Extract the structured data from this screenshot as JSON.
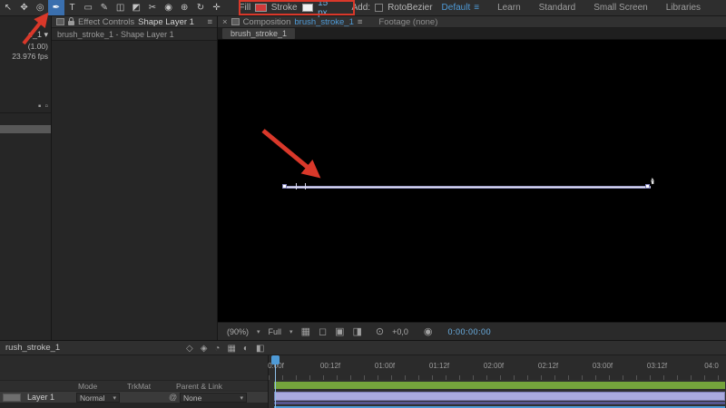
{
  "colors": {
    "accent_blue": "#4e9ad6",
    "timecode_blue": "#6db3e8",
    "annotation_red": "#d9382a",
    "render_green": "#74a33c",
    "layer_lavender": "#aaaade",
    "fill_red": "#cf3a3a"
  },
  "ui": {
    "dropdown": "▾",
    "menu": "≡",
    "close": "×",
    "pickwhip": "@"
  },
  "toolbar": {
    "tools": [
      {
        "id": "selection-tool",
        "glyph": "↖"
      },
      {
        "id": "hand-tool",
        "glyph": "✥"
      },
      {
        "id": "zoom-tool",
        "glyph": "◎"
      },
      {
        "id": "pen-tool",
        "glyph": "✒"
      },
      {
        "id": "type-tool",
        "glyph": "T"
      },
      {
        "id": "rectangle-tool",
        "glyph": "▭"
      },
      {
        "id": "brush-tool",
        "glyph": "✎"
      },
      {
        "id": "clone-stamp-tool",
        "glyph": "◫"
      },
      {
        "id": "eraser-tool",
        "glyph": "◩"
      },
      {
        "id": "roto-brush-tool",
        "glyph": "✂"
      },
      {
        "id": "puppet-pin-tool",
        "glyph": "◉"
      },
      {
        "id": "camera-tool",
        "glyph": "⊕"
      },
      {
        "id": "rotate-tool",
        "glyph": "↻"
      },
      {
        "id": "pan-behind-tool",
        "glyph": "✛"
      }
    ],
    "fill_label": "Fill",
    "stroke_label": "Stroke",
    "stroke_width": "15 px",
    "add_label": "Add:",
    "rotobezier_label": "RotoBezier",
    "workspaces": [
      "Default",
      "Learn",
      "Standard",
      "Small Screen",
      "Libraries"
    ]
  },
  "project_strip": {
    "comp_name_fragment": "e_1 ▾",
    "pixel_aspect_fragment": "(1.00)",
    "framerate_fragment": "23.976 fps",
    "icons": [
      {
        "id": "comp-mini",
        "glyph": "▪"
      },
      {
        "id": "flowchart-mini",
        "glyph": "▫"
      }
    ]
  },
  "effect_controls": {
    "title": "Effect Controls",
    "target": "Shape Layer 1",
    "source_line": "brush_stroke_1 - Shape Layer 1"
  },
  "composition": {
    "tab_label": "Composition",
    "comp_name": "brush_stroke_1",
    "footage_tab_label": "Footage (none)",
    "viewer_tab_label": "brush_stroke_1",
    "statusbar": {
      "zoom": "(90%)",
      "resolution": "Full",
      "icons": [
        {
          "id": "grid-guides",
          "glyph": "▦"
        },
        {
          "id": "mask-visibility",
          "glyph": "◻"
        },
        {
          "id": "region-of-interest",
          "glyph": "▣"
        },
        {
          "id": "channels",
          "glyph": "◨"
        }
      ],
      "exposure_icon_glyph": "⊙",
      "exposure": "+0,0",
      "snapshot_icon_glyph": "◉",
      "timecode": "0:00:00:00"
    }
  },
  "timeline": {
    "tab_label": "rush_stroke_1",
    "header_icons": [
      {
        "id": "mini-flowchart",
        "glyph": "◇"
      },
      {
        "id": "draft-3d",
        "glyph": "◈"
      },
      {
        "id": "hide-shy",
        "glyph": "◔"
      },
      {
        "id": "frame-blending",
        "glyph": "▦"
      },
      {
        "id": "motion-blur",
        "glyph": "◐"
      },
      {
        "id": "graph-editor",
        "glyph": "◧"
      }
    ],
    "columns": {
      "mode": "Mode",
      "trkmat": "TrkMat",
      "parent": "Parent & Link"
    },
    "layer": {
      "name": "Layer 1",
      "blend_mode": "Normal",
      "parent": "None"
    },
    "ruler_labels": [
      "0:00f",
      "00:12f",
      "01:00f",
      "01:12f",
      "02:00f",
      "02:12f",
      "03:00f",
      "03:12f",
      "04:0"
    ]
  }
}
